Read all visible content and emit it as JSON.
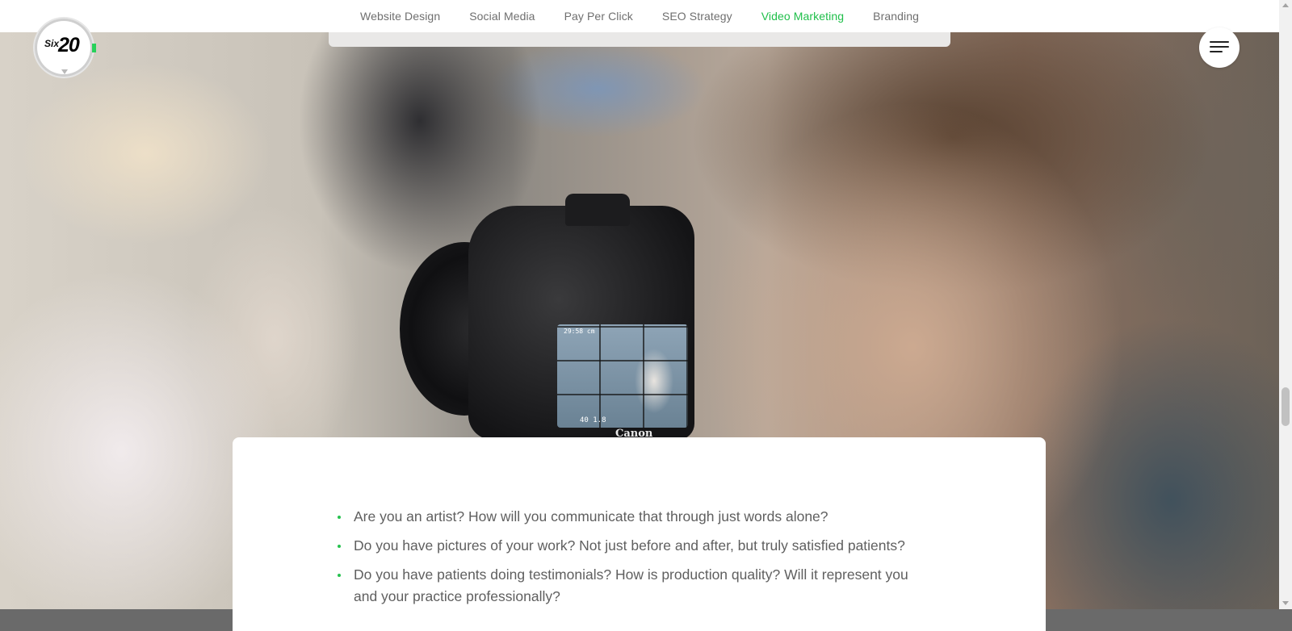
{
  "nav": {
    "items": [
      {
        "label": "Website Design"
      },
      {
        "label": "Social Media"
      },
      {
        "label": "Pay Per Click"
      },
      {
        "label": "SEO Strategy"
      },
      {
        "label": "Video Marketing"
      },
      {
        "label": "Branding"
      }
    ],
    "active_index": 4,
    "active_color": "#1fbf4a"
  },
  "logo": {
    "six": "Six",
    "number": "20",
    "accent_color": "#27d15a"
  },
  "menu": {
    "icon": "hamburger-icon"
  },
  "hero": {
    "camera_readout": "29:58 cm",
    "camera_iso": "40  1.8",
    "camera_brand": "Canon"
  },
  "content": {
    "bullets": [
      "Are you an artist? How will you communicate that through just words alone?",
      "Do you have pictures of your work? Not just before and after, but truly satisfied patients?",
      "Do you have patients doing testimonials? How is production quality? Will it represent you and your practice professionally?"
    ],
    "bullet_color": "#27c24f"
  }
}
